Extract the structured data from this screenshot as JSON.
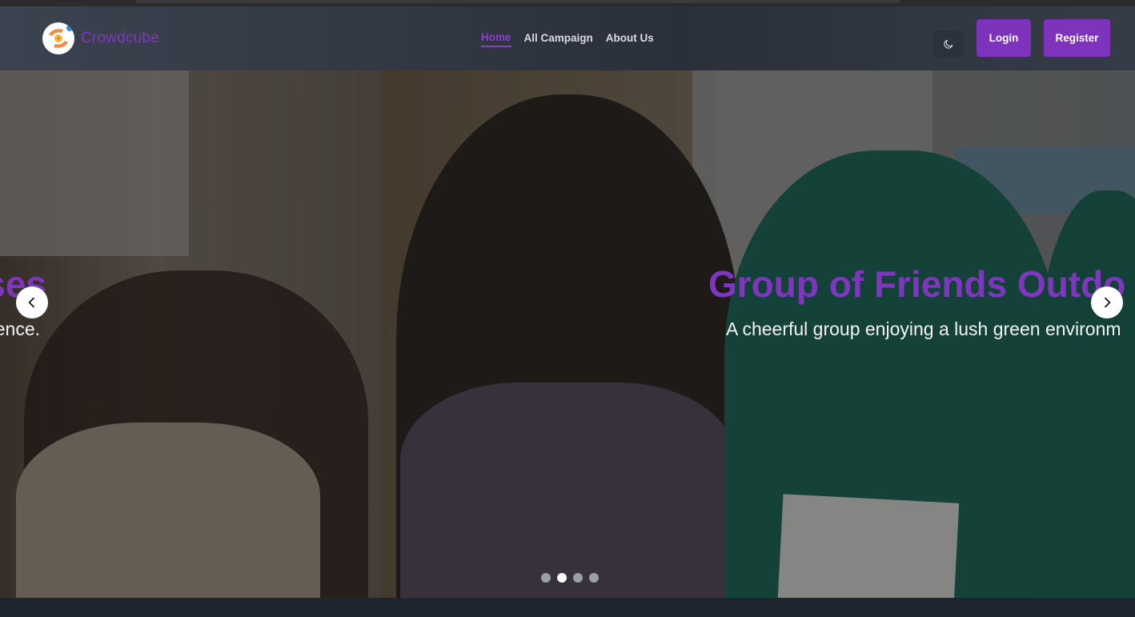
{
  "brand": {
    "name": "Crowdcube",
    "logo_icon": "hands-coin-icon",
    "color": "#7e3ab8"
  },
  "nav": {
    "links": [
      {
        "label": "Home",
        "active": true
      },
      {
        "label": "All Campaign",
        "active": false
      },
      {
        "label": "About Us",
        "active": false
      }
    ],
    "theme_toggle_icon": "moon-icon",
    "login_label": "Login",
    "register_label": "Register"
  },
  "carousel": {
    "slides": [
      {
        "title": "ses",
        "text": "ence."
      },
      {
        "title": "Group of Friends Outdo",
        "text": "A cheerful group enjoying a lush green environm"
      }
    ],
    "prev_icon": "chevron-left-icon",
    "next_icon": "chevron-right-icon",
    "indicator_count": 4,
    "active_indicator": 2
  },
  "colors": {
    "accent": "#7d33bb",
    "caption_title": "#7e36bf",
    "navbar": "#2f3540"
  }
}
